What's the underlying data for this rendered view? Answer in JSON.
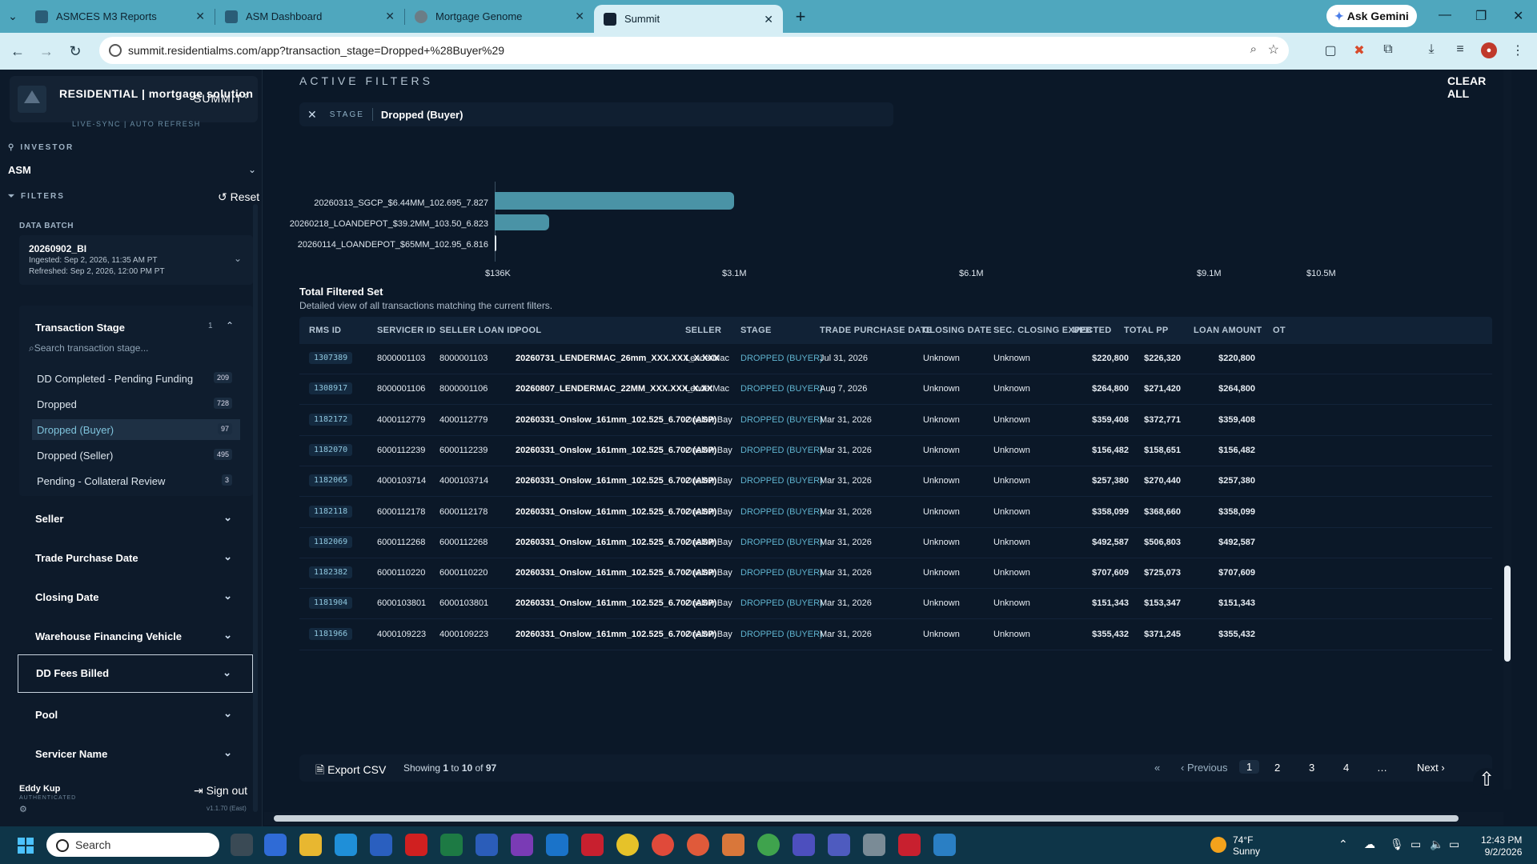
{
  "browser": {
    "tabs": [
      {
        "title": "ASMCES M3 Reports",
        "active": false
      },
      {
        "title": "ASM Dashboard",
        "active": false
      },
      {
        "title": "Mortgage Genome",
        "active": false
      },
      {
        "title": "Summit",
        "active": true
      }
    ],
    "new_tab": "+",
    "ask_gemini": "Ask Gemini",
    "url": "summit.residentialms.com/app?transaction_stage=Dropped+%28Buyer%29"
  },
  "sidebar": {
    "brand_text": "RESIDENTIAL | mortgage solution",
    "brand_product": "SUMMIT",
    "livesync": "LIVE-SYNC | AUTO REFRESH",
    "investor_label": "INVESTOR",
    "investor_value": "ASM",
    "filters_label": "FILTERS",
    "reset_label": "Reset",
    "data_batch_label": "DATA BATCH",
    "batch": {
      "name": "20260902_BI",
      "ingested": "Ingested: Sep 2, 2026, 11:35 AM PT",
      "refreshed": "Refreshed: Sep 2, 2026, 12:00 PM PT"
    },
    "transaction_stage": {
      "title": "Transaction Stage",
      "count": "1",
      "search_placeholder": "Search transaction stage...",
      "items": [
        {
          "label": "DD Completed - Pending Funding",
          "count": "209"
        },
        {
          "label": "Dropped",
          "count": "728"
        },
        {
          "label": "Dropped (Buyer)",
          "count": "97"
        },
        {
          "label": "Dropped (Seller)",
          "count": "495"
        },
        {
          "label": "Pending - Collateral Review",
          "count": "3"
        }
      ]
    },
    "facets": [
      "Seller",
      "Trade Purchase Date",
      "Closing Date",
      "Warehouse Financing Vehicle",
      "DD Fees Billed",
      "Pool",
      "Servicer Name"
    ],
    "user_name": "Eddy Kup",
    "user_status": "AUTHENTICATED",
    "sign_out": "Sign out",
    "version": "v1.1.70 (East)"
  },
  "main": {
    "active_filters_label": "ACTIVE FILTERS",
    "clear_all": "CLEAR ALL",
    "chip": {
      "label": "STAGE",
      "value": "Dropped (Buyer)"
    },
    "table_title": "Total Filtered Set",
    "table_subtitle": "Detailed view of all transactions matching the current filters.",
    "columns": [
      "RMS ID",
      "SERVICER ID",
      "SELLER LOAN ID",
      "POOL",
      "SELLER",
      "STAGE",
      "TRADE PURCHASE DATE",
      "CLOSING DATE",
      "SEC. CLOSING EXPECTED",
      "UPB",
      "TOTAL PP",
      "LOAN AMOUNT",
      "OT"
    ],
    "rows": [
      {
        "rms": "1307389",
        "servicer": "8000001103",
        "seller_loan": "8000001103",
        "pool": "20260731_LENDERMAC_26mm_XXX.XXX_X.XXX",
        "seller": "LenderMac",
        "stage": "DROPPED (BUYER)",
        "tpd": "Jul 31, 2026",
        "closing": "Unknown",
        "sec": "Unknown",
        "upb": "$220,800",
        "pp": "$226,320",
        "loan": "$220,800"
      },
      {
        "rms": "1308917",
        "servicer": "8000001106",
        "seller_loan": "8000001106",
        "pool": "20260807_LENDERMAC_22MM_XXX.XXX_X.XX",
        "seller": "LenderMac",
        "stage": "DROPPED (BUYER)",
        "tpd": "Aug 7, 2026",
        "closing": "Unknown",
        "sec": "Unknown",
        "upb": "$264,800",
        "pp": "$271,420",
        "loan": "$264,800"
      },
      {
        "rms": "1182172",
        "servicer": "4000112779",
        "seller_loan": "4000112779",
        "pool": "20260331_Onslow_161mm_102.525_6.702 (ASP)",
        "seller": "Onslow Bay",
        "stage": "DROPPED (BUYER)",
        "tpd": "Mar 31, 2026",
        "closing": "Unknown",
        "sec": "Unknown",
        "upb": "$359,408",
        "pp": "$372,771",
        "loan": "$359,408"
      },
      {
        "rms": "1182070",
        "servicer": "6000112239",
        "seller_loan": "6000112239",
        "pool": "20260331_Onslow_161mm_102.525_6.702 (ASP)",
        "seller": "Onslow Bay",
        "stage": "DROPPED (BUYER)",
        "tpd": "Mar 31, 2026",
        "closing": "Unknown",
        "sec": "Unknown",
        "upb": "$156,482",
        "pp": "$158,651",
        "loan": "$156,482"
      },
      {
        "rms": "1182065",
        "servicer": "4000103714",
        "seller_loan": "4000103714",
        "pool": "20260331_Onslow_161mm_102.525_6.702 (ASP)",
        "seller": "Onslow Bay",
        "stage": "DROPPED (BUYER)",
        "tpd": "Mar 31, 2026",
        "closing": "Unknown",
        "sec": "Unknown",
        "upb": "$257,380",
        "pp": "$270,440",
        "loan": "$257,380"
      },
      {
        "rms": "1182118",
        "servicer": "6000112178",
        "seller_loan": "6000112178",
        "pool": "20260331_Onslow_161mm_102.525_6.702 (ASP)",
        "seller": "Onslow Bay",
        "stage": "DROPPED (BUYER)",
        "tpd": "Mar 31, 2026",
        "closing": "Unknown",
        "sec": "Unknown",
        "upb": "$358,099",
        "pp": "$368,660",
        "loan": "$358,099"
      },
      {
        "rms": "1182069",
        "servicer": "6000112268",
        "seller_loan": "6000112268",
        "pool": "20260331_Onslow_161mm_102.525_6.702 (ASP)",
        "seller": "Onslow Bay",
        "stage": "DROPPED (BUYER)",
        "tpd": "Mar 31, 2026",
        "closing": "Unknown",
        "sec": "Unknown",
        "upb": "$492,587",
        "pp": "$506,803",
        "loan": "$492,587"
      },
      {
        "rms": "1182382",
        "servicer": "6000110220",
        "seller_loan": "6000110220",
        "pool": "20260331_Onslow_161mm_102.525_6.702 (ASP)",
        "seller": "Onslow Bay",
        "stage": "DROPPED (BUYER)",
        "tpd": "Mar 31, 2026",
        "closing": "Unknown",
        "sec": "Unknown",
        "upb": "$707,609",
        "pp": "$725,073",
        "loan": "$707,609"
      },
      {
        "rms": "1181904",
        "servicer": "6000103801",
        "seller_loan": "6000103801",
        "pool": "20260331_Onslow_161mm_102.525_6.702 (ASP)",
        "seller": "Onslow Bay",
        "stage": "DROPPED (BUYER)",
        "tpd": "Mar 31, 2026",
        "closing": "Unknown",
        "sec": "Unknown",
        "upb": "$151,343",
        "pp": "$153,347",
        "loan": "$151,343"
      },
      {
        "rms": "1181966",
        "servicer": "4000109223",
        "seller_loan": "4000109223",
        "pool": "20260331_Onslow_161mm_102.525_6.702 (ASP)",
        "seller": "Onslow Bay",
        "stage": "DROPPED (BUYER)",
        "tpd": "Mar 31, 2026",
        "closing": "Unknown",
        "sec": "Unknown",
        "upb": "$355,432",
        "pp": "$371,245",
        "loan": "$355,432"
      }
    ],
    "pager": {
      "export": "Export CSV",
      "showing_prefix": "Showing",
      "from": "1",
      "to_word": "to",
      "to": "10",
      "of_word": "of",
      "total": "97",
      "first": "«",
      "prev": "‹ Previous",
      "pages": [
        "1",
        "2",
        "3",
        "4",
        "…"
      ],
      "next": "Next ›"
    }
  },
  "chart_data": {
    "type": "bar",
    "orientation": "horizontal",
    "categories": [
      "20260313_SGCP_$6.44MM_102.695_7.827",
      "20260218_LOANDEPOT_$39.2MM_103.50_6.823",
      "20260114_LOANDEPOT_$65MM_102.95_6.816"
    ],
    "values": [
      2600000,
      700000,
      145000
    ],
    "x_ticks": [
      "$136K",
      "$3.1M",
      "$6.1M",
      "$9.1M",
      "$10.5M"
    ],
    "xlim": [
      136000,
      10500000
    ],
    "bar_color": "#4a93a6"
  },
  "taskbar": {
    "search_placeholder": "Search",
    "weather_temp": "74°F",
    "weather_desc": "Sunny",
    "time": "12:43 PM",
    "date": "9/2/2026"
  }
}
